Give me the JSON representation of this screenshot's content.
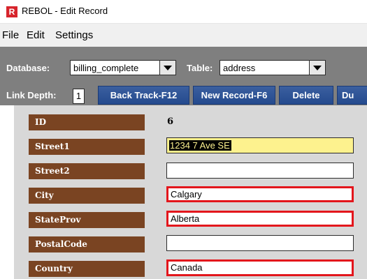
{
  "window": {
    "title": "REBOL - Edit Record",
    "icon_letter": "R",
    "icon_name": "rebol-app-icon"
  },
  "menu": [
    "File",
    "Edit",
    "Settings"
  ],
  "toolbar": {
    "database_label": "Database:",
    "database_value": "billing_complete",
    "table_label": "Table:",
    "table_value": "address",
    "link_depth_label": "Link Depth:",
    "link_depth_value": "1",
    "buttons": {
      "back_track": "Back Track-F12",
      "new_record": "New Record-F6",
      "delete": "Delete",
      "truncated": "Du"
    }
  },
  "record": {
    "id_label": "ID",
    "id_value": "6",
    "fields": [
      {
        "label": "Street1",
        "value": "1234 7 Ave SE"
      },
      {
        "label": "Street2",
        "value": ""
      },
      {
        "label": "City",
        "value": "Calgary"
      },
      {
        "label": "StateProv",
        "value": "Alberta"
      },
      {
        "label": "PostalCode",
        "value": ""
      },
      {
        "label": "Country",
        "value": "Canada"
      }
    ]
  },
  "colors": {
    "label_bg": "#7a4422",
    "button_bg": "#2b4f93",
    "toolbar_bg": "#7f7f7f",
    "required_border": "#e3161c",
    "focus_bg": "#fdf28e"
  }
}
